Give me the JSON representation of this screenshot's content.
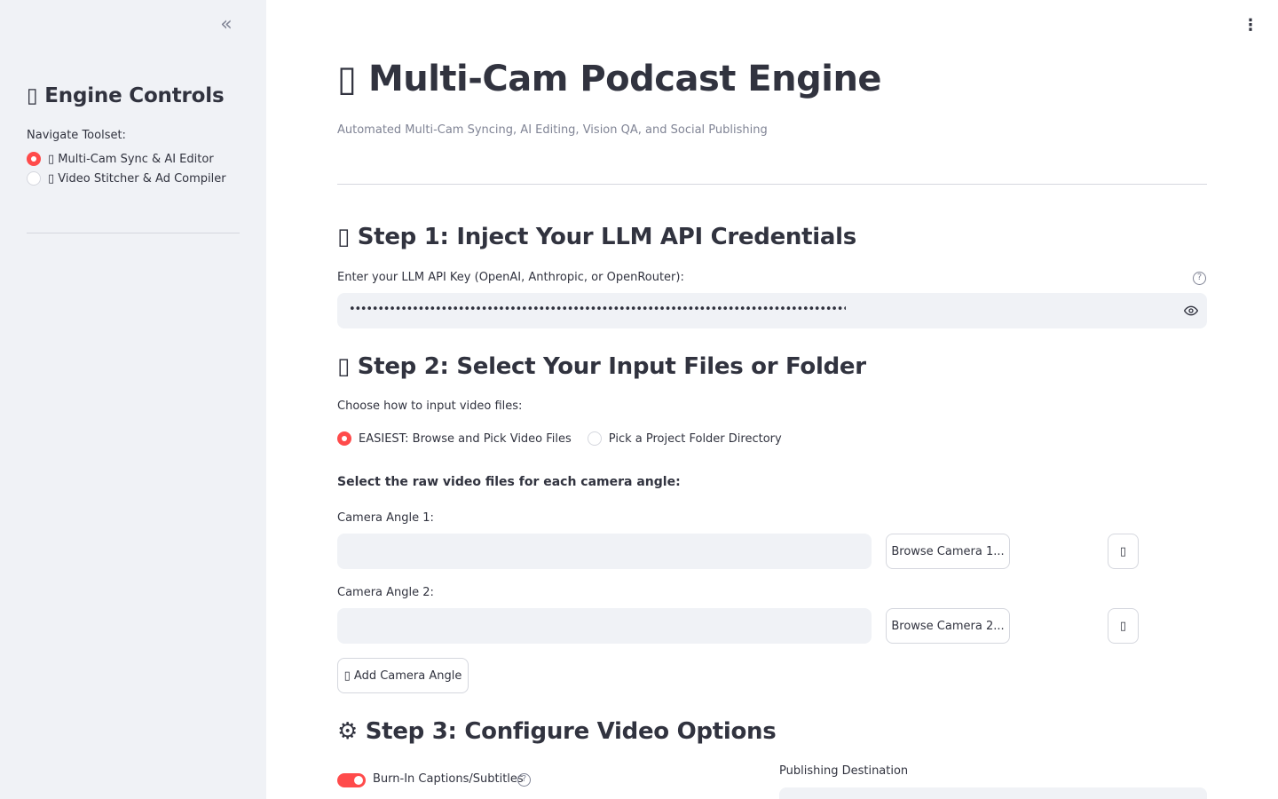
{
  "sidebar": {
    "collapse_icon": "«",
    "title": "▯ Engine Controls",
    "nav_label": "Navigate Toolset:",
    "nav_options": [
      {
        "label": "▯ Multi-Cam Sync & AI Editor",
        "selected": true
      },
      {
        "label": "▯ Video Stitcher & Ad Compiler",
        "selected": false
      }
    ]
  },
  "header": {
    "menu_icon": "⋮",
    "title": "▯ Multi-Cam Podcast Engine",
    "subtitle": "Automated Multi-Cam Syncing, AI Editing, Vision QA, and Social Publishing"
  },
  "step1": {
    "heading": "▯ Step 1: Inject Your LLM API Credentials",
    "label": "Enter your LLM API Key (OpenAI, Anthropic, or OpenRouter):",
    "help_icon": "?",
    "value": "••••••••••••••••••••••••••••••••••••••••••••••••••••••••••••••••••••••••••••••••••••••••••••••••••••••••••••••••••••••"
  },
  "step2": {
    "heading": "▯ Step 2: Select Your Input Files or Folder",
    "mode_label": "Choose how to input video files:",
    "modes": [
      {
        "label": "EASIEST: Browse and Pick Video Files",
        "selected": true
      },
      {
        "label": "Pick a Project Folder Directory",
        "selected": false
      }
    ],
    "files_label": "Select the raw video files for each camera angle:",
    "cameras": [
      {
        "label": "Camera Angle 1:",
        "value": "",
        "browse_label": "Browse Camera 1...",
        "remove_icon": "▯"
      },
      {
        "label": "Camera Angle 2:",
        "value": "",
        "browse_label": "Browse Camera 2...",
        "remove_icon": "▯"
      }
    ],
    "add_label": "▯ Add Camera Angle"
  },
  "step3": {
    "heading": "⚙ Step 3: Configure Video Options",
    "captions_label": "Burn-In Captions/Subtitles",
    "captions_on": true,
    "help_icon": "?",
    "publishing_label": "Publishing Destination"
  },
  "colors": {
    "accent": "#ff4b4b",
    "sidebar_bg": "#f0f2f6",
    "text": "#31333f",
    "muted": "#808495",
    "border": "#d5d7de"
  }
}
